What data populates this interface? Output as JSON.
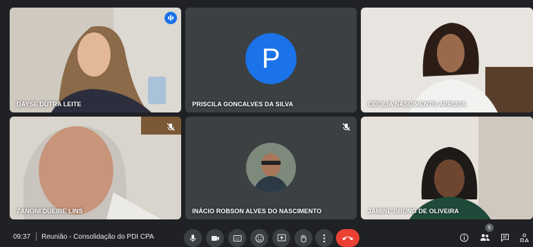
{
  "participants": [
    {
      "name": "DAYSE DUTRA LEITE"
    },
    {
      "name": "PRISCILA GONCALVES DA SILVA",
      "avatar_letter": "P"
    },
    {
      "name": "CECILIA NASCIMENTO ARRUDA"
    },
    {
      "name": "ZANONI DUEIRE LINS"
    },
    {
      "name": "INÁCIO ROBSON ALVES DO NASCIMENTO"
    },
    {
      "name": "JAMINE BRUNO DE OLIVEIRA"
    }
  ],
  "bottom_bar": {
    "time": "09:37",
    "meeting_title": "Reunião - Consolidação do PDI CPA",
    "participant_count": "6"
  },
  "icons": {
    "controls": [
      "microphone-icon",
      "camera-icon",
      "captions-icon",
      "emoji-icon",
      "present-icon",
      "raise-hand-icon",
      "more-icon",
      "end-call-icon"
    ],
    "right": [
      "info-icon",
      "people-icon",
      "chat-icon",
      "activities-icon"
    ]
  },
  "colors": {
    "background": "#202124",
    "tile": "#3c4043",
    "accent_blue": "#1a73e8",
    "speaking_border": "#8ab4f8",
    "end_call_red": "#ea4335"
  }
}
